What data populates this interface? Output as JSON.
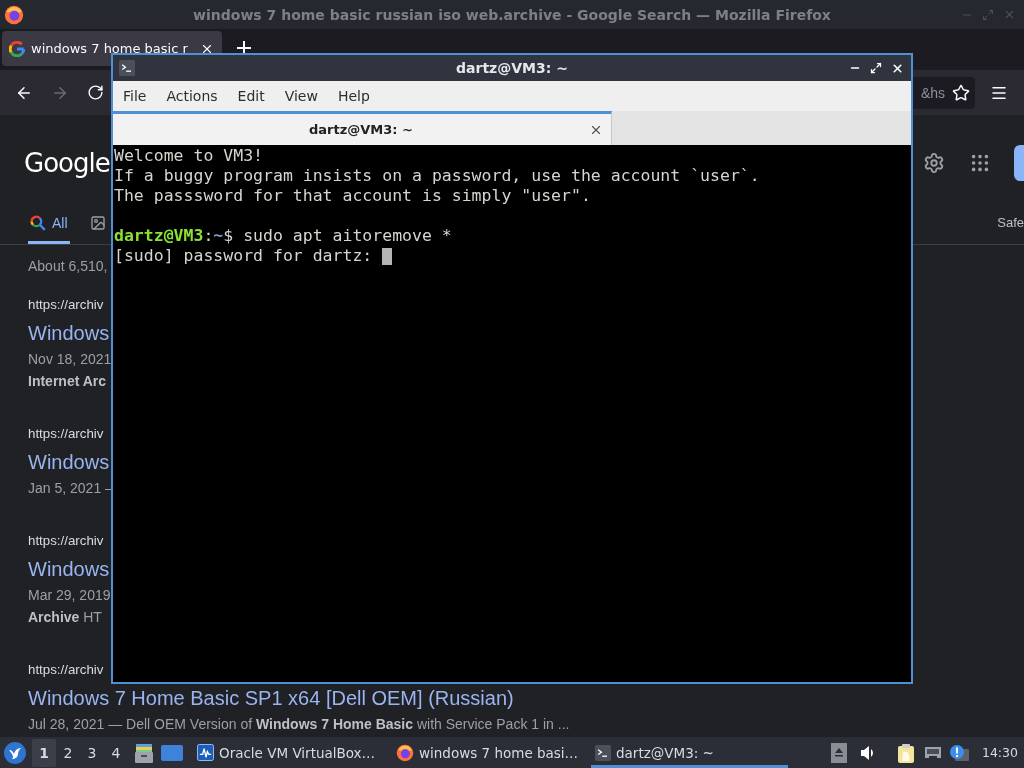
{
  "browser": {
    "window_title": "windows 7 home basic russian iso web.archive - Google Search — Mozilla Firefox",
    "tabs": [
      {
        "label": "windows 7 home basic r",
        "selected": true
      }
    ],
    "address_fragment": "&hs",
    "page": {
      "logo": "Google",
      "search_tabs": [
        {
          "kind": "all",
          "label": "All",
          "selected": true
        },
        {
          "kind": "images",
          "selected": false
        }
      ],
      "safesearch": "Safe",
      "result_stats": "About 6,510,",
      "results": [
        {
          "url": "https://archiv",
          "title": "Windows",
          "snippet_lines": [
            {
              "text": "Nov 18, 2021",
              "bold": false
            },
            {
              "text": "Internet Arc",
              "bold": true
            }
          ]
        },
        {
          "url": "https://archiv",
          "title": "Windows",
          "snippet_lines": [
            {
              "text": "Jan 5, 2021 –",
              "bold": false
            }
          ]
        },
        {
          "url": "https://archiv",
          "title": "Windows",
          "snippet_lines": [
            {
              "text": "Mar 29, 2019",
              "bold": false
            },
            {
              "text": "**Archive** HT",
              "bold": false
            }
          ]
        },
        {
          "url": "https://archiv",
          "title": "Windows 7 Home Basic SP1 x64 [Dell OEM] (Russian)",
          "snippet_lines": [
            {
              "text": "Jul 28, 2021 — Dell OEM Version of **Windows 7 Home Basic** with Service Pack 1 in ...",
              "bold": false
            }
          ]
        }
      ]
    }
  },
  "terminal": {
    "title": "dartz@VM3: ~",
    "menu": [
      "File",
      "Actions",
      "Edit",
      "View",
      "Help"
    ],
    "tabs": [
      {
        "label": "dartz@VM3: ~",
        "selected": true
      }
    ],
    "lines": [
      {
        "kind": "output",
        "text": "Welcome to VM3!"
      },
      {
        "kind": "output",
        "text": "If a buggy program insists on a password, use the account `user`."
      },
      {
        "kind": "output",
        "text": "The passsword for that account is simply \"user\"."
      },
      {
        "kind": "blank"
      },
      {
        "kind": "prompt",
        "user_host": "dartz@VM3",
        "separator": ":",
        "path": "~",
        "command": "$ sudo apt aitoremove *"
      },
      {
        "kind": "output",
        "text": "[sudo] password for dartz:"
      }
    ],
    "cursor": true
  },
  "taskbar": {
    "workspaces": [
      {
        "label": "1",
        "selected": true
      },
      {
        "label": "2",
        "selected": false
      },
      {
        "label": "3",
        "selected": false
      },
      {
        "label": "4",
        "selected": false
      }
    ],
    "tasks": [
      {
        "kind": "vmmanager",
        "label": "Oracle VM VirtualBox…",
        "selected": false
      },
      {
        "kind": "browser",
        "label": "windows 7 home basi…",
        "selected": false
      },
      {
        "kind": "terminal",
        "label": "dartz@VM3: ~",
        "selected": true
      }
    ],
    "clock": "14:30"
  }
}
